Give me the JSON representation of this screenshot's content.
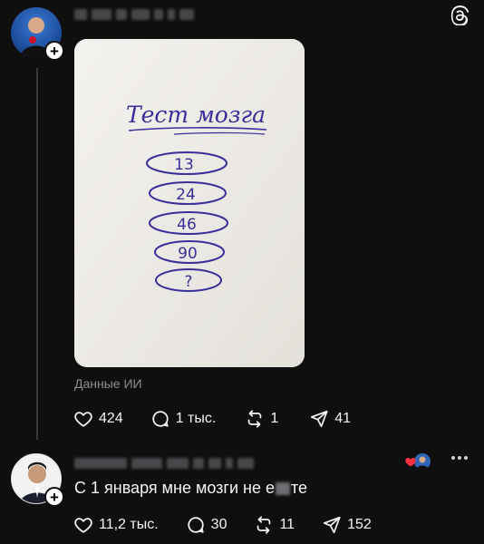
{
  "post": {
    "ai_label": "Данные ИИ",
    "image": {
      "title": "Тест мозга",
      "items": [
        "13",
        "24",
        "46",
        "90",
        "?"
      ]
    },
    "stats": {
      "likes": "424",
      "replies": "1 тыс.",
      "reposts": "1",
      "shares": "41"
    }
  },
  "reply": {
    "text_before": "С 1 января мне мозги не е",
    "text_after": "те",
    "stats": {
      "likes": "11,2 тыс.",
      "replies": "30",
      "reposts": "11",
      "shares": "152"
    }
  },
  "colors": {
    "background": "#0f0f10",
    "text": "#f3f5f7",
    "muted": "#8d8d91",
    "heart_red": "#ff3040",
    "ink_blue": "#3a2f9a"
  },
  "icons": [
    "threads-logo-icon",
    "plus-icon",
    "heart-icon",
    "comment-icon",
    "repost-icon",
    "share-icon",
    "more-icon"
  ]
}
